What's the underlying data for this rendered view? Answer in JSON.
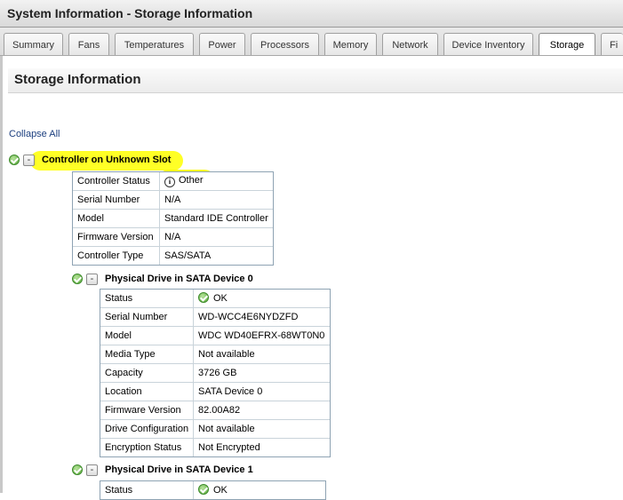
{
  "window": {
    "title": "System Information - Storage Information"
  },
  "tabs": [
    {
      "label": "Summary",
      "active": false
    },
    {
      "label": "Fans",
      "active": false
    },
    {
      "label": "Temperatures",
      "active": false
    },
    {
      "label": "Power",
      "active": false
    },
    {
      "label": "Processors",
      "active": false
    },
    {
      "label": "Memory",
      "active": false
    },
    {
      "label": "Network",
      "active": false
    },
    {
      "label": "Device Inventory",
      "active": false
    },
    {
      "label": "Storage",
      "active": true
    },
    {
      "label": "Fi",
      "active": false
    }
  ],
  "section": {
    "title": "Storage Information"
  },
  "collapse_all": "Collapse All",
  "controller": {
    "title": "Controller on Unknown Slot",
    "status_icon": "ok-icon",
    "toggle": "-",
    "rows": [
      {
        "label": "Controller Status",
        "value": "Other",
        "icon": "info-icon"
      },
      {
        "label": "Serial Number",
        "value": "N/A"
      },
      {
        "label": "Model",
        "value": "Standard IDE Controller"
      },
      {
        "label": "Firmware Version",
        "value": "N/A"
      },
      {
        "label": "Controller Type",
        "value": "SAS/SATA"
      }
    ]
  },
  "drive0": {
    "title": "Physical Drive in SATA Device 0",
    "status_icon": "ok-icon",
    "toggle": "-",
    "rows": [
      {
        "label": "Status",
        "value": "OK",
        "icon": "ok-icon"
      },
      {
        "label": "Serial Number",
        "value": "WD-WCC4E6NYDZFD"
      },
      {
        "label": "Model",
        "value": "WDC WD40EFRX-68WT0N0"
      },
      {
        "label": "Media Type",
        "value": "Not available"
      },
      {
        "label": "Capacity",
        "value": "3726 GB"
      },
      {
        "label": "Location",
        "value": "SATA Device 0"
      },
      {
        "label": "Firmware Version",
        "value": "82.00A82"
      },
      {
        "label": "Drive Configuration",
        "value": "Not available"
      },
      {
        "label": "Encryption Status",
        "value": "Not Encrypted"
      }
    ]
  },
  "drive1": {
    "title": "Physical Drive in SATA Device 1",
    "status_icon": "ok-icon",
    "toggle": "-",
    "rows": [
      {
        "label": "Status",
        "value": "OK",
        "icon": "ok-icon"
      }
    ]
  },
  "colors": {
    "highlight": "#ffff00",
    "link": "#1c3f7f",
    "ok": "#5aaa3a"
  }
}
